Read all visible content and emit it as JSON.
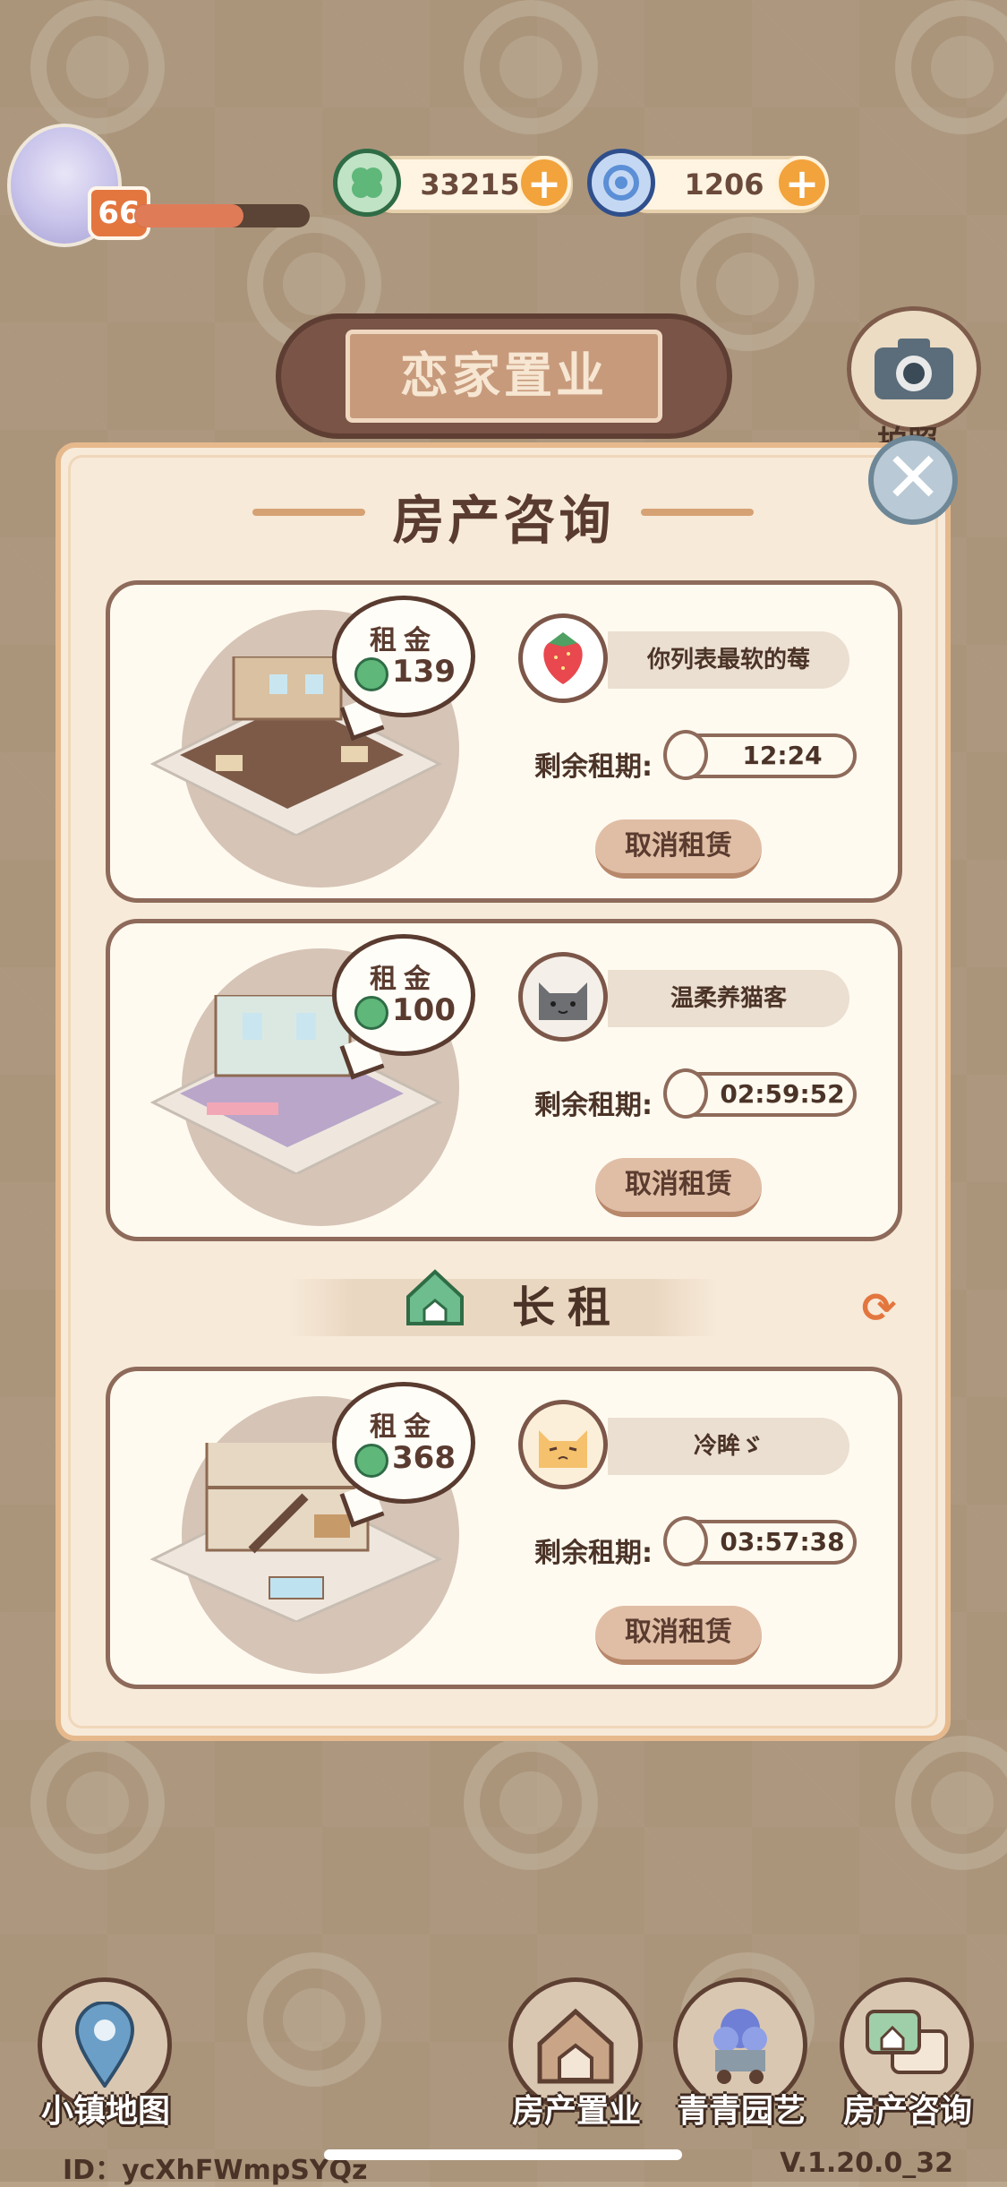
{
  "player": {
    "level": "66",
    "exp_progress": 0.62
  },
  "currencies": [
    {
      "icon": "clover-coin-icon",
      "amount": "33215",
      "color": "#5fb77a"
    },
    {
      "icon": "swirl-gem-icon",
      "amount": "1206",
      "color": "#5b8fd6"
    }
  ],
  "sign": {
    "title": "恋家置业"
  },
  "camera": {
    "label": "拍照"
  },
  "modal": {
    "title": "房产咨询",
    "long_rent_label": "长租",
    "cards": [
      {
        "rent_label": "租金",
        "rent": "139",
        "tenant": "你列表最软的莓",
        "tenant_avatar": "strawberry-avatar",
        "lease_label": "剩余租期:",
        "remaining": "12:24",
        "cancel": "取消租赁"
      },
      {
        "rent_label": "租金",
        "rent": "100",
        "tenant": "温柔养猫客",
        "tenant_avatar": "gray-cat-avatar",
        "lease_label": "剩余租期:",
        "remaining": "02:59:52",
        "cancel": "取消租赁"
      },
      {
        "rent_label": "租金",
        "rent": "368",
        "tenant": "冷眸ゞ",
        "tenant_avatar": "orange-cat-avatar",
        "lease_label": "剩余租期:",
        "remaining": "03:57:38",
        "cancel": "取消租赁"
      }
    ]
  },
  "nav": [
    {
      "label": "小镇地图",
      "icon": "map-pin-icon"
    },
    {
      "label": "房产置业",
      "icon": "house-sign-icon"
    },
    {
      "label": "青青园艺",
      "icon": "flower-cart-icon"
    },
    {
      "label": "房产咨询",
      "icon": "chat-house-icon"
    }
  ],
  "footer": {
    "id": "ID：ycXhFWmpSYQz",
    "version": "V.1.20.0_32"
  },
  "colors": {
    "accent": "#e3763f",
    "panel": "#f7ead9",
    "border": "#8e6a5a"
  }
}
